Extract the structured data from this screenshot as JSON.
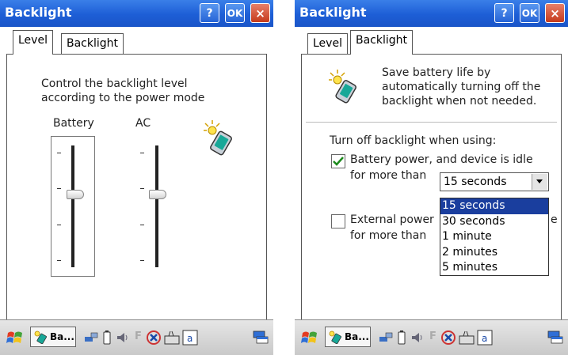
{
  "left": {
    "title": "Backlight",
    "help_label": "?",
    "ok_label": "OK",
    "close_label": "×",
    "tabs": [
      {
        "label": "Level",
        "active": true
      },
      {
        "label": "Backlight",
        "active": false
      }
    ],
    "description_line1": "Control the backlight level",
    "description_line2": "according to the power mode",
    "battery_label": "Battery",
    "ac_label": "AC",
    "battery_level_fraction": 0.6,
    "ac_level_fraction": 0.6,
    "taskbar_button": "Ba..."
  },
  "right": {
    "title": "Backlight",
    "help_label": "?",
    "ok_label": "OK",
    "close_label": "×",
    "tabs": [
      {
        "label": "Level",
        "active": false
      },
      {
        "label": "Backlight",
        "active": true
      }
    ],
    "info_line1": "Save battery life by",
    "info_line2": "automatically turning off the",
    "info_line3": "backlight when not needed.",
    "turn_off_heading": "Turn off backlight when using:",
    "battery_option_line1": "Battery power, and device is idle",
    "battery_option_line2": "for more than",
    "battery_checked": true,
    "battery_timeout_value": "15 seconds",
    "external_option_line1": "External power",
    "external_option_trailing": "e",
    "external_option_line2": "for more than",
    "external_checked": false,
    "dropdown_options": [
      "15 seconds",
      "30 seconds",
      "1 minute",
      "2 minutes",
      "5 minutes"
    ],
    "dropdown_selected_index": 0,
    "taskbar_button": "Ba..."
  },
  "colors": {
    "titlebar": "#1d5ed6",
    "close": "#c53a1c",
    "selection": "#1a3e9e",
    "check": "#1d8a1d"
  }
}
